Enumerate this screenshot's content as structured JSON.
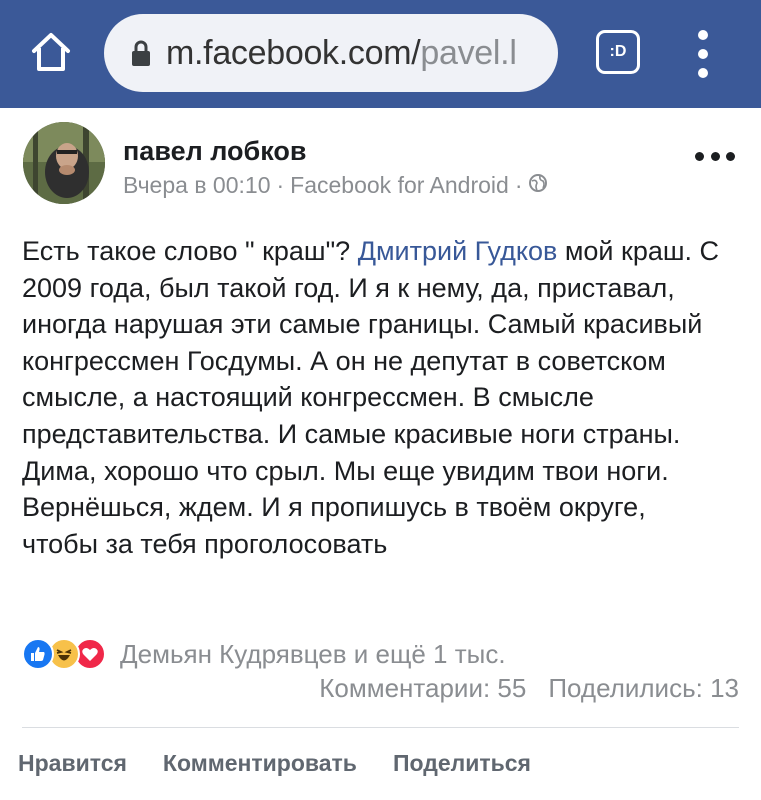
{
  "browser": {
    "url_domain": "m.facebook.com/",
    "url_path": "pavel.l",
    "tab_label": ":D",
    "colors": {
      "bar": "#3b5998",
      "url_bg": "#f0f2f7"
    },
    "icons": [
      "home-icon",
      "lock-icon",
      "tab-switcher-icon",
      "kebab-menu-icon"
    ]
  },
  "post": {
    "author": "павел лобков",
    "timestamp": "Вчера в 00:10",
    "separator": "·",
    "app": "Facebook for Android",
    "privacy_icon": "globe-icon",
    "text_before": "Есть такое слово \" краш\"? ",
    "mention": "Дмитрий Гудков",
    "text_after": " мой краш. С 2009 года, был такой год. И я к нему, да, приставал, иногда нарушая эти самые границы. Самый красивый конгрессмен Госдумы. А он не депутат в советском смысле, а настоящий конгрессмен. В смысле представительства. И самые красивые ноги страны. Дима, хорошо что срыл. Мы еще увидим твои ноги. Вернёшься, ждем. И я пропишусь в твоём округе, чтобы за тебя проголосовать"
  },
  "reactions": {
    "icons": [
      "like-icon",
      "haha-icon",
      "love-icon"
    ],
    "summary": "Демьян Кудрявцев и ещё 1 тыс.",
    "comments": "Комментарии: 55",
    "shares": "Поделились: 13"
  },
  "actions": {
    "like": "Нравится",
    "comment": "Комментировать",
    "share": "Поделиться"
  }
}
